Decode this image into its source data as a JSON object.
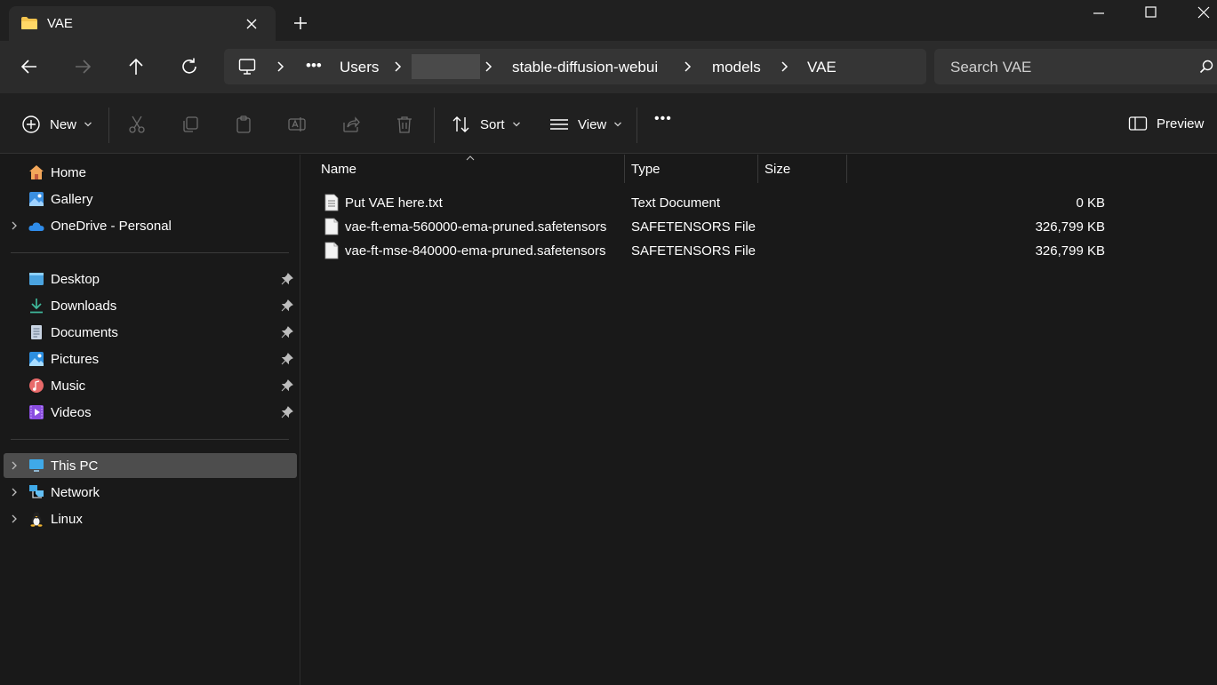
{
  "tab": {
    "title": "VAE"
  },
  "address": {
    "segments": [
      "Users",
      "stable-diffusion-webui",
      "models",
      "VAE"
    ],
    "more": "•••"
  },
  "search": {
    "placeholder": "Search VAE"
  },
  "toolbar": {
    "new_label": "New",
    "sort_label": "Sort",
    "view_label": "View",
    "more_label": "•••",
    "preview_label": "Preview"
  },
  "sidebar": {
    "top": [
      {
        "label": "Home",
        "icon": "home-icon"
      },
      {
        "label": "Gallery",
        "icon": "gallery-icon"
      },
      {
        "label": "OneDrive - Personal",
        "icon": "cloud-icon"
      }
    ],
    "quick": [
      {
        "label": "Desktop",
        "icon": "desktop-icon"
      },
      {
        "label": "Downloads",
        "icon": "download-icon"
      },
      {
        "label": "Documents",
        "icon": "documents-icon"
      },
      {
        "label": "Pictures",
        "icon": "pictures-icon"
      },
      {
        "label": "Music",
        "icon": "music-icon"
      },
      {
        "label": "Videos",
        "icon": "videos-icon"
      }
    ],
    "devices": [
      {
        "label": "This PC",
        "icon": "pc-icon"
      },
      {
        "label": "Network",
        "icon": "network-icon"
      },
      {
        "label": "Linux",
        "icon": "linux-icon"
      }
    ]
  },
  "columns": {
    "name": "Name",
    "type": "Type",
    "size": "Size"
  },
  "files": [
    {
      "name": "Put VAE here.txt",
      "type": "Text Document",
      "size": "0 KB"
    },
    {
      "name": "vae-ft-ema-560000-ema-pruned.safetensors",
      "type": "SAFETENSORS File",
      "size": "326,799 KB"
    },
    {
      "name": "vae-ft-mse-840000-ema-pruned.safetensors",
      "type": "SAFETENSORS File",
      "size": "326,799 KB"
    }
  ],
  "colors": {
    "folder": "#f4c44e",
    "accent": "#4cc2ff",
    "selected": "#4d4d4d"
  }
}
